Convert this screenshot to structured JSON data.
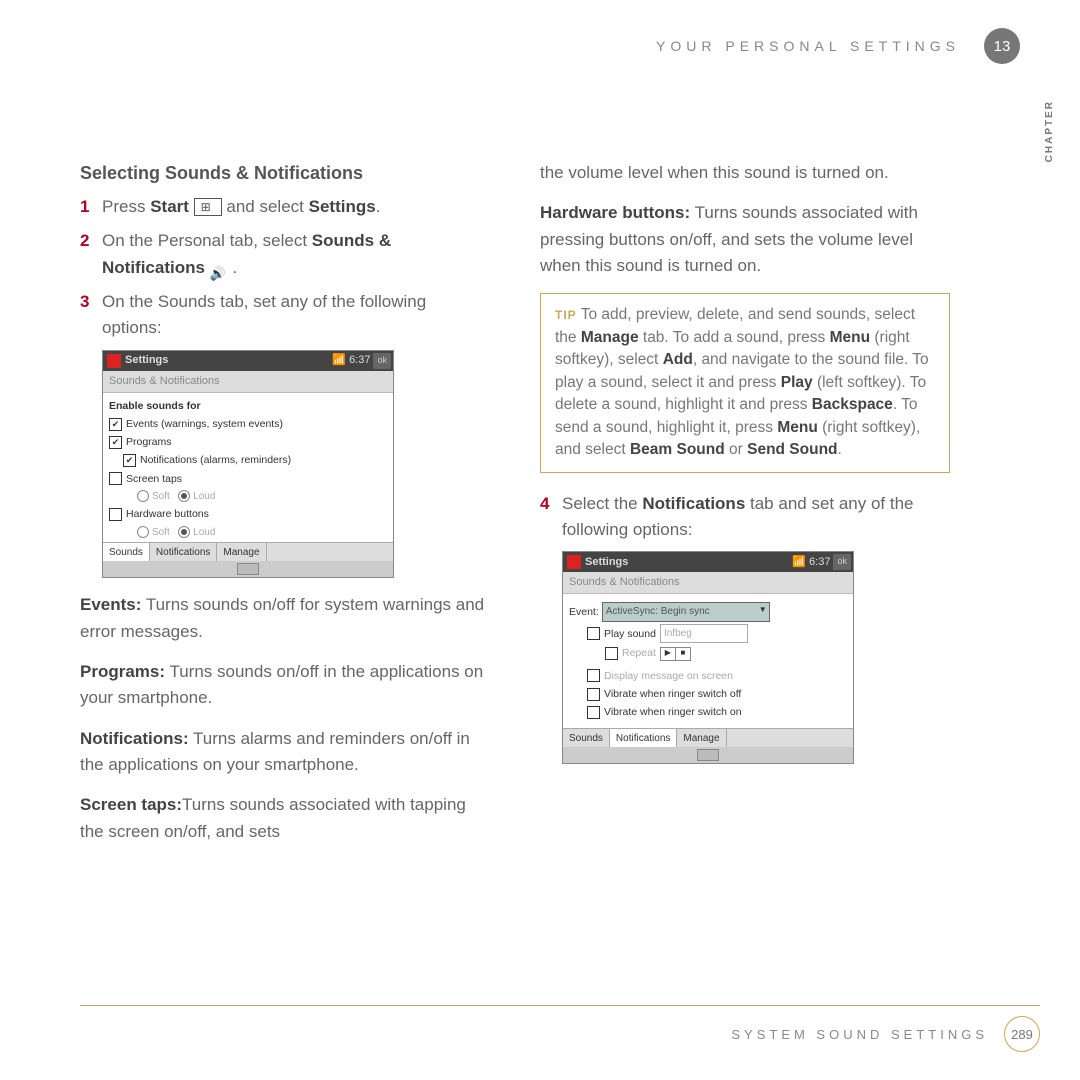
{
  "header": {
    "title": "YOUR PERSONAL SETTINGS",
    "chapter_number": "13",
    "chapter_label": "CHAPTER"
  },
  "section_title": "Selecting Sounds & Notifications",
  "steps": {
    "s1a": "Press ",
    "s1b": "Start",
    "s1c": " and select ",
    "s1d": "Settings",
    "s1e": ".",
    "s2a": "On the Personal tab, select ",
    "s2b": "Sounds & Notifications",
    "s2c": " .",
    "s3a": "On the Sounds tab, set any of the following options:",
    "s4a": "Select the ",
    "s4b": "Notifications",
    "s4c": " tab and set any of the following options:"
  },
  "nums": {
    "n1": "1",
    "n2": "2",
    "n3": "3",
    "n4": "4"
  },
  "screenshot1": {
    "title": "Settings",
    "time": "6:37",
    "ok": "ok",
    "subtitle": "Sounds & Notifications",
    "header": "Enable sounds for",
    "opt1": "Events (warnings, system events)",
    "opt2": "Programs",
    "opt3": "Notifications (alarms, reminders)",
    "opt4": "Screen taps",
    "opt5": "Hardware buttons",
    "soft": "Soft",
    "loud": "Loud",
    "tabs": [
      "Sounds",
      "Notifications",
      "Manage"
    ]
  },
  "descriptions": {
    "events_t": "Events:",
    "events": " Turns sounds on/off for system warnings and error messages.",
    "programs_t": "Programs:",
    "programs": " Turns sounds on/off in the applications on your smartphone.",
    "notifications_t": "Notifications:",
    "notifications": " Turns alarms and reminders on/off in the applications on your smartphone.",
    "screentaps_t": "Screen taps:",
    "screentaps": " Turns sounds associated with tapping the screen on/off, and sets the volume level when this sound is turned on.",
    "hwbuttons_t": "Hardware buttons:",
    "hwbuttons": " Turns sounds associated with pressing buttons on/off, and sets the volume level when this sound is turned on."
  },
  "tip": {
    "label": "TIP",
    "p1": "To add, preview, delete, and send sounds, select the ",
    "b1": "Manage",
    "p2": " tab. To add a sound, press ",
    "b2": "Menu",
    "p3": " (right softkey), select ",
    "b3": "Add",
    "p4": ", and navigate to the sound file. To play a sound, select it and press ",
    "b4": "Play",
    "p5": " (left softkey). To delete a sound, highlight it and press ",
    "b5": "Backspace",
    "p6": ". To send a sound, highlight it, press ",
    "b6": "Menu",
    "p7": " (right softkey), and select ",
    "b7": "Beam Sound",
    "p8": " or ",
    "b8": "Send Sound",
    "p9": "."
  },
  "screenshot2": {
    "title": "Settings",
    "time": "6:37",
    "ok": "ok",
    "subtitle": "Sounds & Notifications",
    "event_label": "Event:",
    "event_value": "ActiveSync: Begin sync",
    "play_sound": "Play sound",
    "sound_name": "Infbeg",
    "repeat": "Repeat",
    "display_msg": "Display message on screen",
    "vibrate_off": "Vibrate when ringer switch off",
    "vibrate_on": "Vibrate when ringer switch on",
    "tabs": [
      "Sounds",
      "Notifications",
      "Manage"
    ]
  },
  "footer": {
    "title": "SYSTEM SOUND SETTINGS",
    "page": "289"
  }
}
